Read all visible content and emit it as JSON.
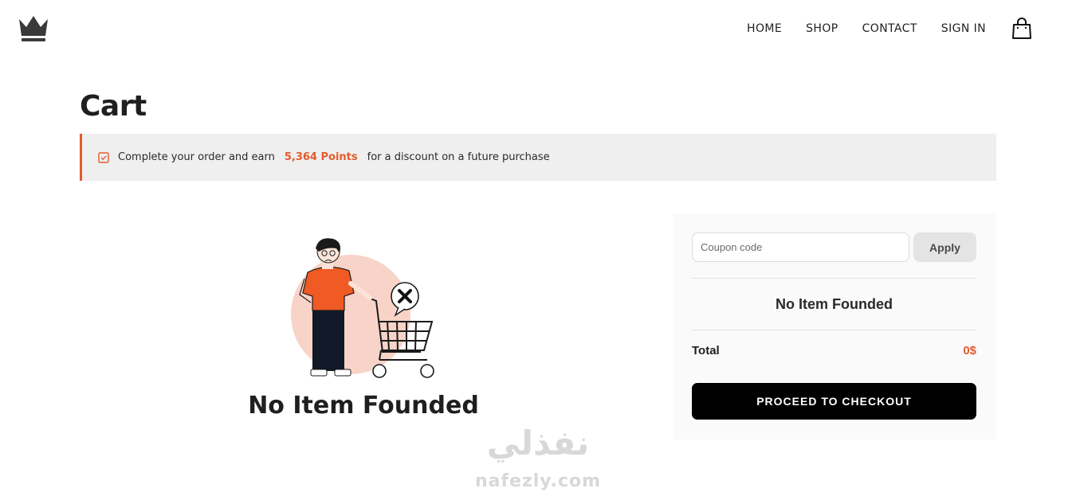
{
  "header": {
    "logo_icon": "crown-icon",
    "nav": [
      {
        "label": "HOME"
      },
      {
        "label": "SHOP"
      },
      {
        "label": "CONTACT"
      },
      {
        "label": "SIGN IN"
      }
    ],
    "bag_icon": "shopping-bag-icon"
  },
  "page": {
    "title": "Cart"
  },
  "banner": {
    "icon": "checkbox-icon",
    "text_before": "Complete your order and earn",
    "points": "5,364 Points",
    "text_after": "for a discount on a future purchase"
  },
  "empty_state": {
    "illustration": "empty-cart-illustration",
    "message": "No Item Founded"
  },
  "summary": {
    "coupon_placeholder": "Coupon code",
    "coupon_value": "",
    "apply_label": "Apply",
    "empty_message": "No Item Founded",
    "total_label": "Total",
    "total_value": "0$",
    "checkout_label": "PROCEED TO CHECKOUT"
  },
  "watermark": {
    "arabic": "نفذلي",
    "latin": "nafezly.com"
  },
  "colors": {
    "accent": "#e35b2c",
    "banner_bg": "#efefef",
    "panel_bg": "#fafafa",
    "checkout_bg": "#000000"
  }
}
